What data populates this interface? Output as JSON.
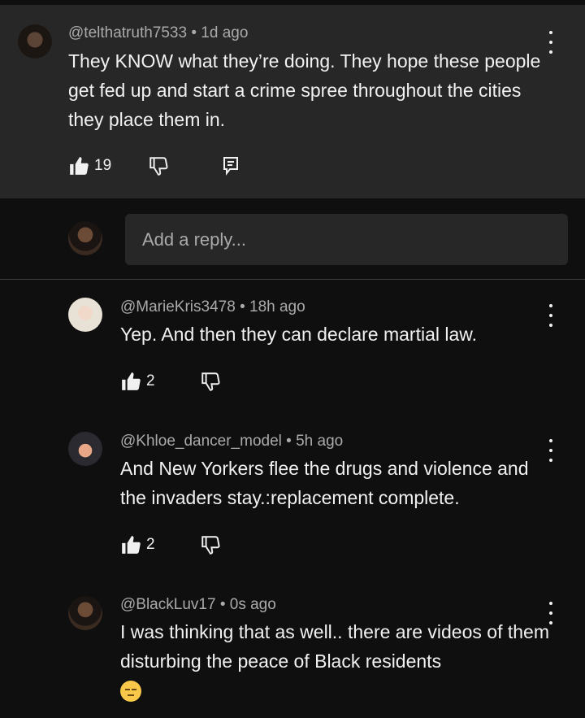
{
  "parent_comment": {
    "handle": "@telthatruth7533",
    "time": "1d ago",
    "text": "They KNOW what they’re doing.  They hope these people get fed up and start a crime spree throughout the cities they place them in.",
    "likes": "19"
  },
  "reply_input": {
    "placeholder": "Add a reply..."
  },
  "replies": [
    {
      "handle": "@MarieKris3478",
      "time": "18h ago",
      "text": "Yep.  And then they can declare martial law.",
      "likes": "2"
    },
    {
      "handle": "@Khloe_dancer_model",
      "time": "5h ago",
      "text": "And New Yorkers flee  the drugs and violence and the invaders stay.:replacement complete.",
      "likes": "2"
    },
    {
      "handle": "@BlackLuv17",
      "time": "0s ago",
      "text": "I was thinking that as well.. there are videos of them disturbing the peace of Black residents",
      "emoji": "pensive-face-emoji"
    }
  ],
  "separator": "•",
  "colors": {
    "background": "#0f0f0f",
    "highlight": "#272727",
    "text": "#f1f1f1",
    "meta": "#aaaaaa"
  }
}
